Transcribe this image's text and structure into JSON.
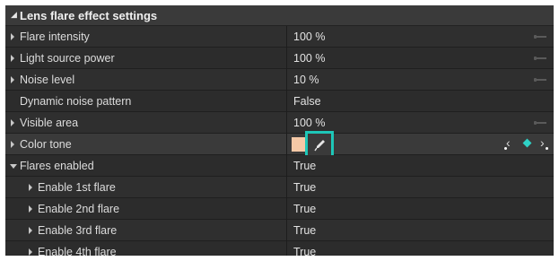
{
  "panel": {
    "title": "Lens flare effect settings",
    "accent_color": "#1ec7b8",
    "swatch_color": "#f5c8a6"
  },
  "rows": [
    {
      "label": "Flare intensity",
      "value": "100 %"
    },
    {
      "label": "Light source power",
      "value": "100 %"
    },
    {
      "label": "Noise level",
      "value": "10 %"
    },
    {
      "label": "Dynamic noise pattern",
      "value": "False"
    },
    {
      "label": "Visible area",
      "value": "100 %"
    },
    {
      "label": "Color tone",
      "value": ""
    },
    {
      "label": "Flares enabled",
      "value": "True"
    },
    {
      "label": "Enable 1st flare",
      "value": "True"
    },
    {
      "label": "Enable 2nd flare",
      "value": "True"
    },
    {
      "label": "Enable 3rd flare",
      "value": "True"
    },
    {
      "label": "Enable 4th flare",
      "value": "True"
    }
  ],
  "icons": {
    "header_collapse": "triangle-down-icon",
    "row_expand": "triangle-right-icon",
    "reset": "reset-slider-icon",
    "eyedropper": "eyedropper-icon",
    "prev_keyframe": "chevron-left-icon",
    "keyframe": "diamond-keyframe-icon",
    "next_keyframe": "chevron-right-icon"
  }
}
